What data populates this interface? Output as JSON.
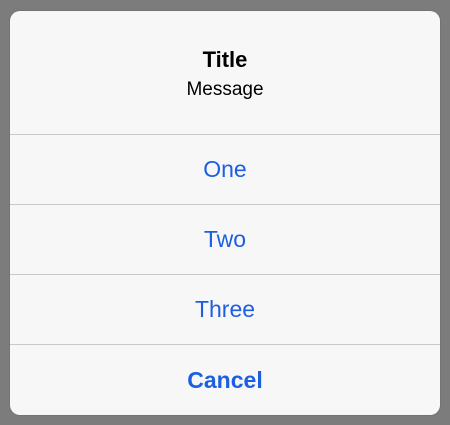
{
  "alert": {
    "title": "Title",
    "message": "Message",
    "actions": [
      {
        "label": "One"
      },
      {
        "label": "Two"
      },
      {
        "label": "Three"
      }
    ],
    "cancel_label": "Cancel"
  },
  "colors": {
    "overlay": "#7c7c7c",
    "alert_background": "#f7f7f7",
    "action_text": "#1c5fe0",
    "divider": "#c9c9cc"
  }
}
